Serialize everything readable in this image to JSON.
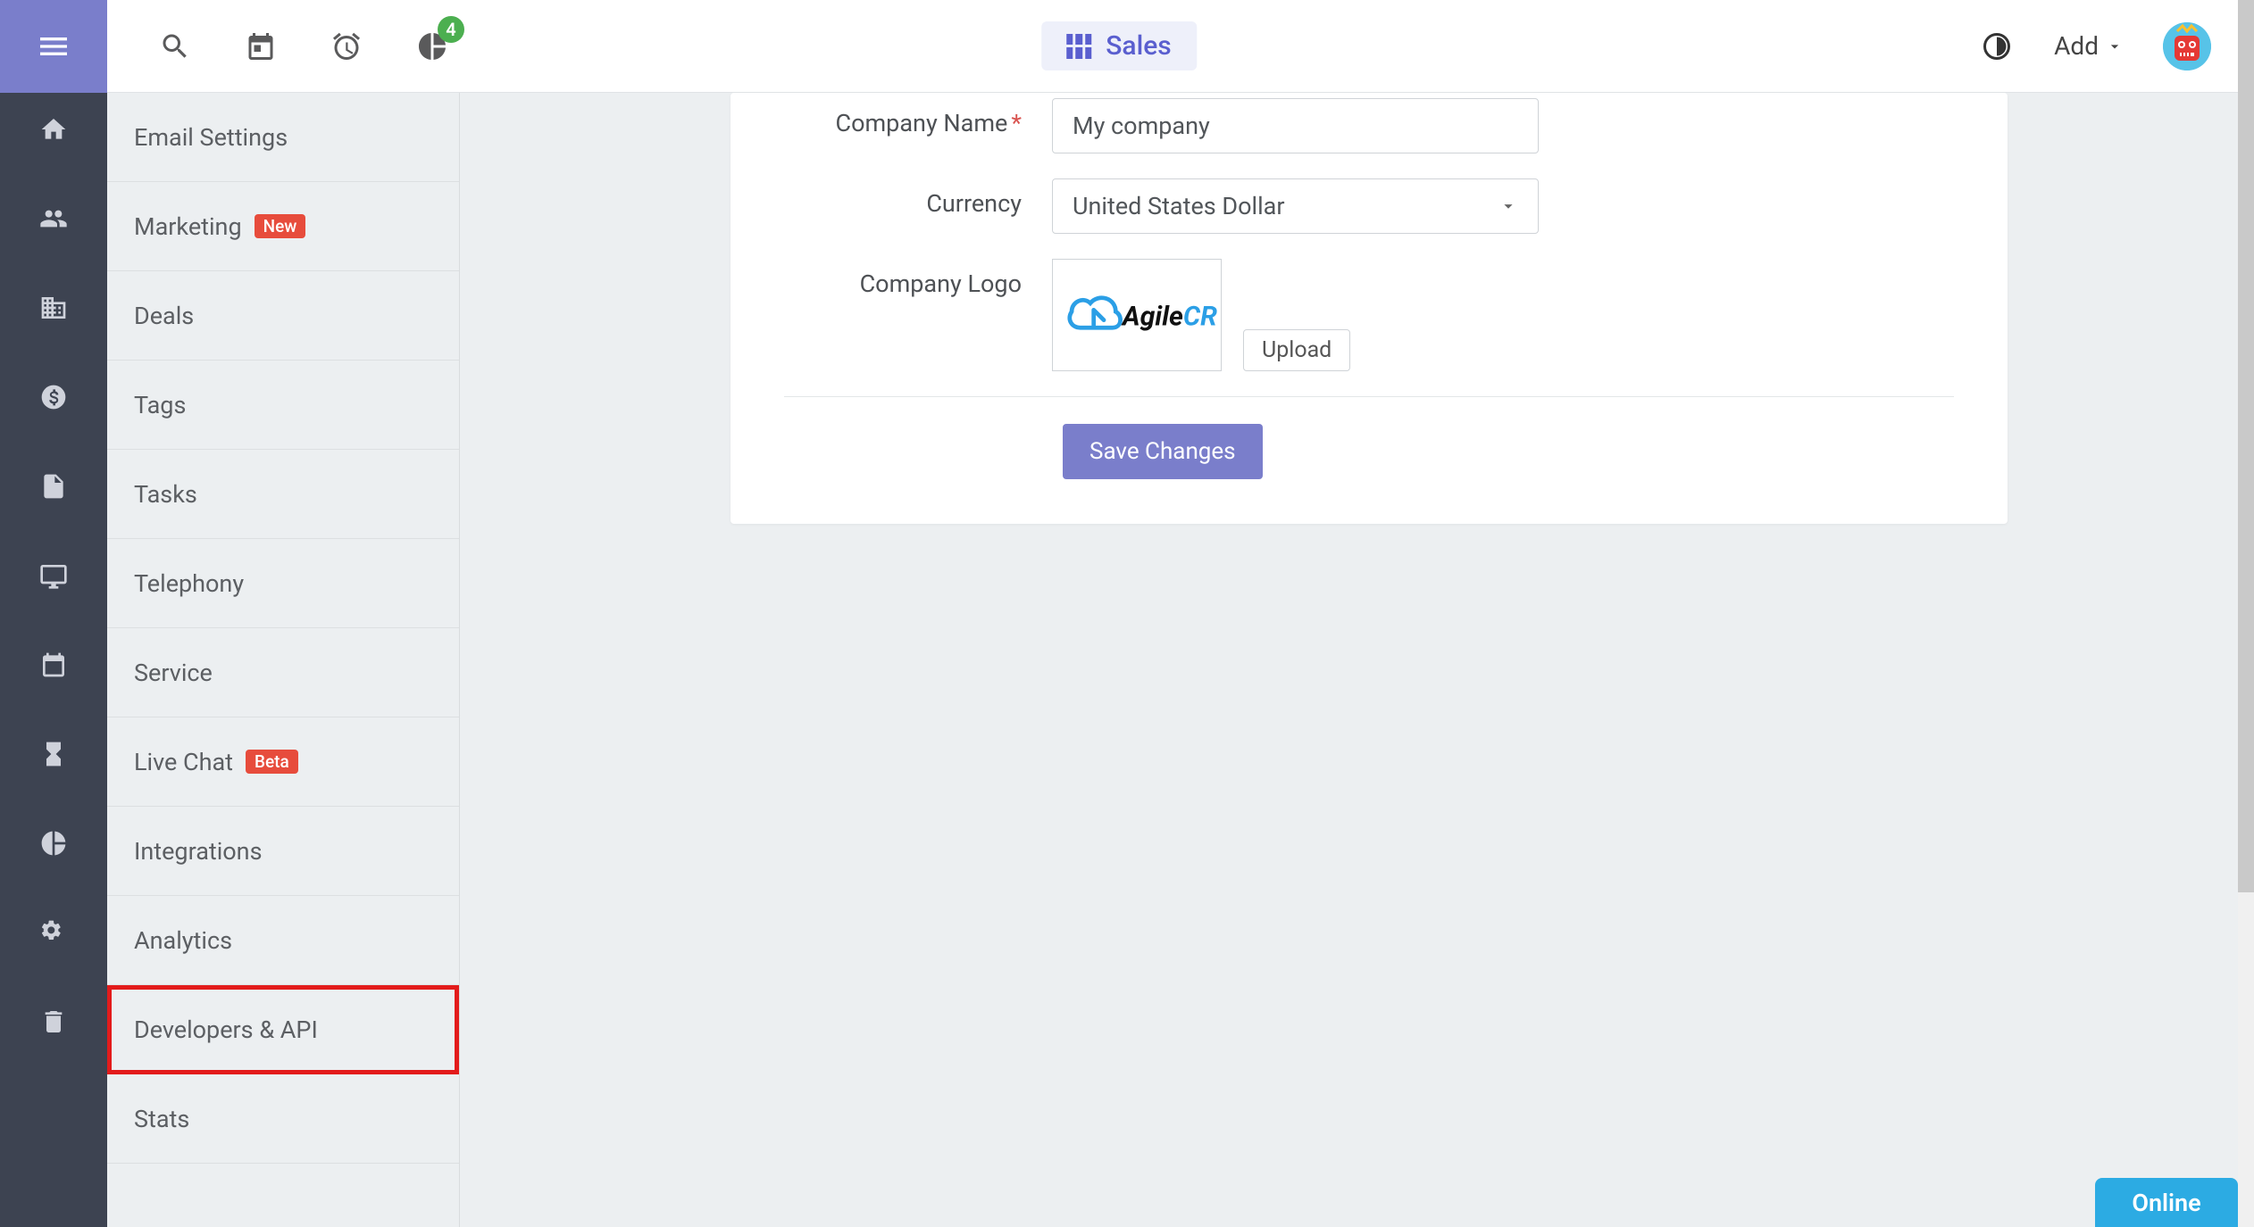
{
  "header": {
    "sales_label": "Sales",
    "add_label": "Add",
    "notif_count": "4"
  },
  "settings_menu": {
    "items": [
      {
        "label": "Email Settings",
        "badge": null
      },
      {
        "label": "Marketing",
        "badge": "New"
      },
      {
        "label": "Deals",
        "badge": null
      },
      {
        "label": "Tags",
        "badge": null
      },
      {
        "label": "Tasks",
        "badge": null
      },
      {
        "label": "Telephony",
        "badge": null
      },
      {
        "label": "Service",
        "badge": null
      },
      {
        "label": "Live Chat",
        "badge": "Beta"
      },
      {
        "label": "Integrations",
        "badge": null
      },
      {
        "label": "Analytics",
        "badge": null
      },
      {
        "label": "Developers & API",
        "badge": null,
        "highlighted": true
      },
      {
        "label": "Stats",
        "badge": null
      }
    ]
  },
  "form": {
    "company_name_label": "Company Name",
    "company_name_value": "My company",
    "currency_label": "Currency",
    "currency_value": "United States Dollar",
    "logo_label": "Company Logo",
    "upload_label": "Upload",
    "save_label": "Save Changes",
    "logo_text1": "Agile",
    "logo_text2": "CRM"
  },
  "status": {
    "online": "Online"
  }
}
